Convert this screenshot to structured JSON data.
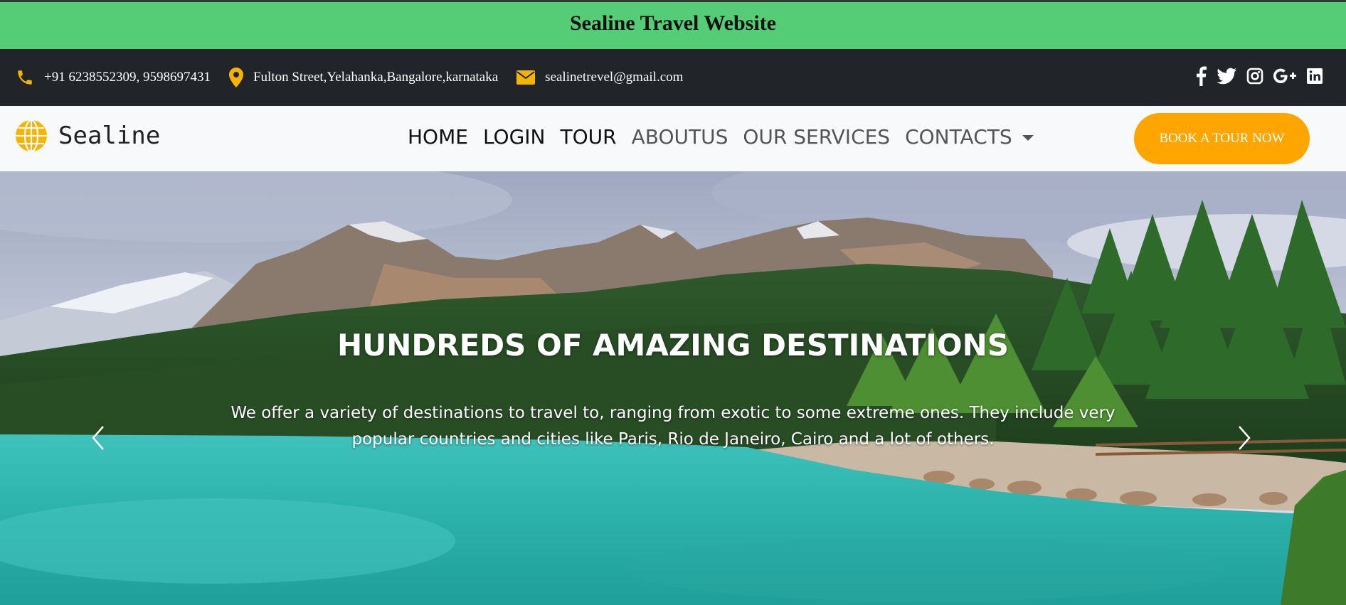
{
  "banner": {
    "title": "Sealine Travel Website"
  },
  "topbar": {
    "phone": "+91 6238552309, 9598697431",
    "address": "Fulton Street,Yelahanka,Bangalore,karnataka",
    "email": "sealinetrevel@gmail.com",
    "phone_icon": "phone-icon",
    "address_icon": "map-marker-icon",
    "email_icon": "envelope-icon",
    "social_icons": [
      "facebook-icon",
      "twitter-icon",
      "instagram-icon",
      "google-plus-icon",
      "linkedin-icon"
    ]
  },
  "navbar": {
    "brand": "Sealine",
    "brand_icon": "globe-icon",
    "links": [
      "HOME",
      "LOGIN",
      "TOUR",
      "ABOUTUS",
      "OUR SERVICES",
      "CONTACTS"
    ],
    "cta": "BOOK A TOUR NOW"
  },
  "hero": {
    "heading": "HUNDREDS OF AMAZING DESTINATIONS",
    "text": "We offer a variety of destinations to travel to, ranging from exotic to some extreme ones. They include very popular countries and cities like Paris, Rio de Janeiro, Cairo and a lot of others."
  },
  "colors": {
    "banner": "#55cd76",
    "topbar": "#212529",
    "accent": "#ffa500",
    "icon_yellow": "#f5b400",
    "navbar": "#f8f9fa"
  }
}
